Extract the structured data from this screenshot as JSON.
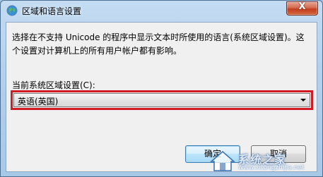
{
  "window": {
    "title": "区域和语言设置",
    "close_glyph": "X",
    "icon": "globe-icon"
  },
  "dialog": {
    "description": "选择在不支持 Unicode 的程序中显示文本时所使用的语言(系统区域设置)。这个设置对计算机上的所有用户帐户都有影响。",
    "locale_label": "当前系统区域设置(C):",
    "locale_selected": "英语(英国)",
    "ok_label": "确定",
    "cancel_label": "取消"
  },
  "watermark": {
    "text": "系统之家",
    "url": "www.xitongzhijia.net"
  },
  "colors": {
    "highlight_border": "#d11a24",
    "close_button": "#c23d1f"
  }
}
